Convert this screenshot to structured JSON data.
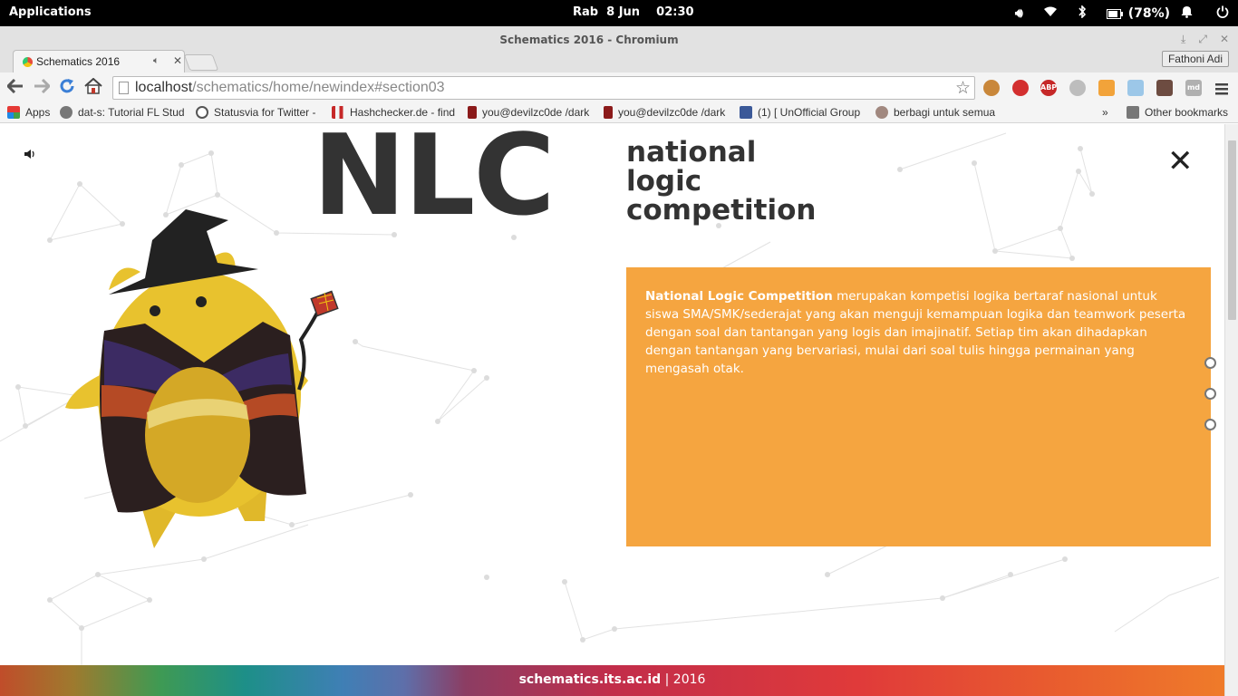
{
  "topbar": {
    "apps": "Applications",
    "clock": "Rab  8 Jun    02:30",
    "battery": "(78%)"
  },
  "window": {
    "title": "Schematics 2016 - Chromium"
  },
  "tab": {
    "title": "Schematics 2016",
    "profile": "Fathoni Adi"
  },
  "omnibox": {
    "host": "localhost",
    "path": "/schematics/home/newindex#section03"
  },
  "bookmarks": {
    "items": [
      "Apps",
      "dat-s: Tutorial FL Stud",
      "Statusvia for Twitter -",
      "Hashchecker.de - find",
      "you@devilzc0de /dark",
      "you@devilzc0de /dark",
      "(1) [ UnOfficial Group",
      "berbagi untuk semua"
    ],
    "overflow": "»",
    "other": "Other bookmarks"
  },
  "page": {
    "heading": "NLC",
    "subtitle_1": "national",
    "subtitle_2": "logic",
    "subtitle_3": "competition",
    "close": "✕",
    "desc_bold": "National Logic Competition",
    "desc_rest": " merupakan kompetisi logika bertaraf nasional untuk siswa SMA/SMK/sederajat yang akan menguji kemampuan logika dan teamwork peserta dengan soal dan tantangan yang logis dan imajinatif. Setiap tim akan dihadapkan dengan tantangan yang bervariasi, mulai dari soal tulis hingga permainan yang mengasah otak.",
    "footer_site": "schematics.its.ac.id",
    "footer_sep": " | ",
    "footer_year": "2016"
  },
  "colors": {
    "accent_orange": "#f5a540",
    "heading": "#333333"
  }
}
